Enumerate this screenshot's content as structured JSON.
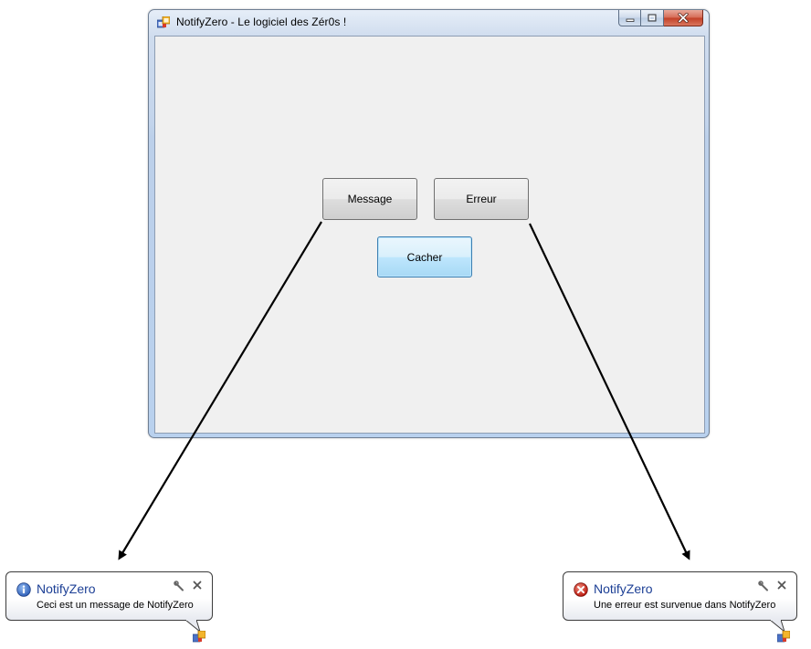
{
  "window": {
    "title": "NotifyZero - Le logiciel des Zér0s !",
    "app_icon": "windows-form-icon",
    "controls": {
      "minimize_icon": "minimize-icon",
      "maximize_icon": "maximize-icon",
      "close_icon": "close-icon"
    }
  },
  "buttons": {
    "message_label": "Message",
    "error_label": "Erreur",
    "hide_label": "Cacher"
  },
  "notifications": {
    "info": {
      "icon": "info-icon",
      "title": "NotifyZero",
      "text": "Ceci est un message de NotifyZero",
      "accent_color": "#1c3f95"
    },
    "error": {
      "icon": "error-icon",
      "title": "NotifyZero",
      "text": "Une erreur est survenue dans NotifyZero",
      "accent_color": "#1c3f95"
    }
  }
}
